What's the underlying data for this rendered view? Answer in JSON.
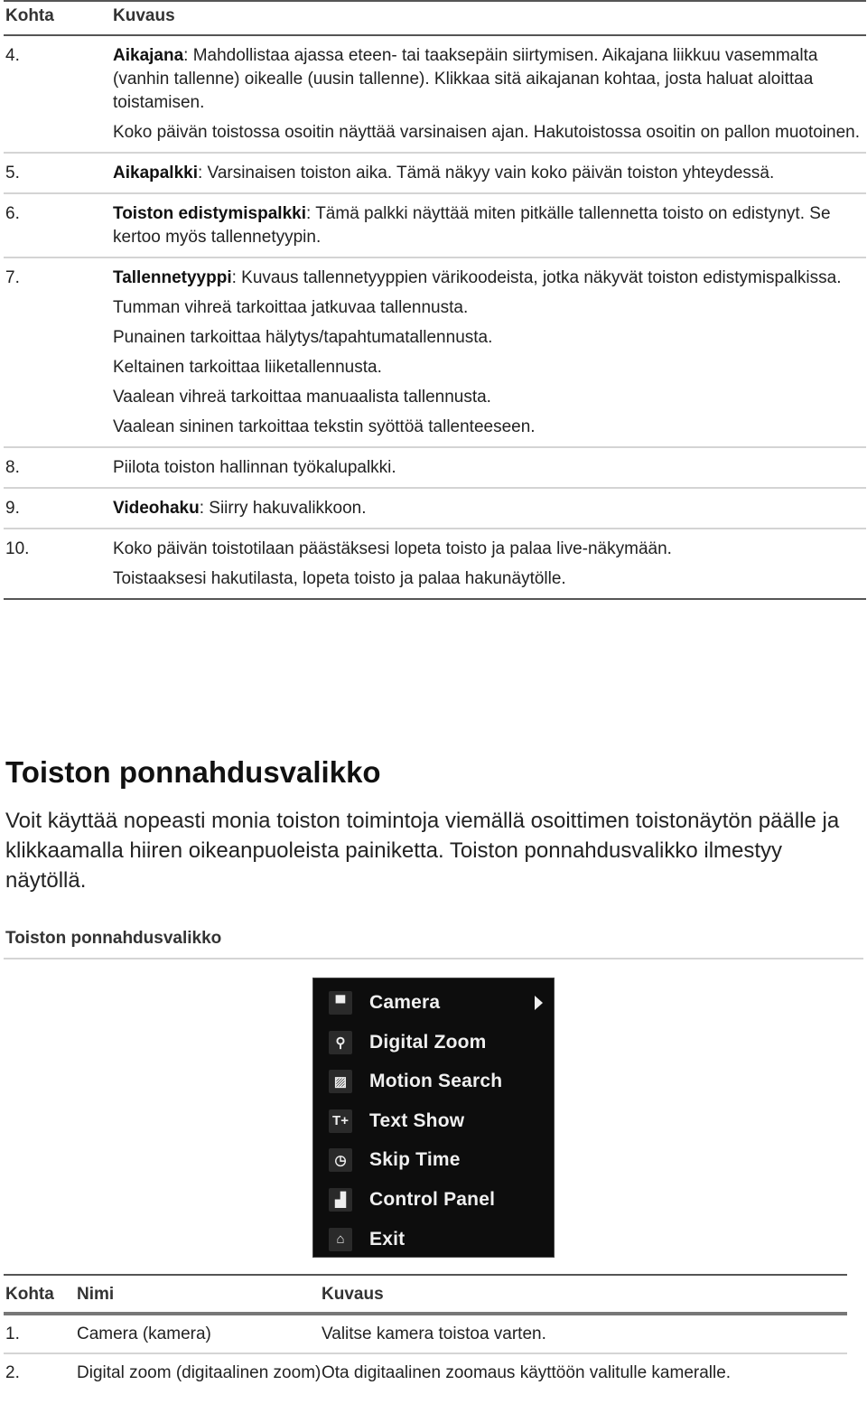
{
  "table1": {
    "headers": {
      "item": "Kohta",
      "description": "Kuvaus"
    },
    "rows": [
      {
        "num": "4.",
        "term": "Aikajana",
        "text": ": Mahdollistaa ajassa eteen- tai taaksepäin siirtymisen. Aikajana liikkuu vasemmalta (vanhin tallenne) oikealle (uusin tallenne). Klikkaa sitä aikajanan kohtaa, josta haluat aloittaa toistamisen.",
        "extra": [
          "Koko päivän toistossa osoitin näyttää varsinaisen ajan. Hakutoistossa osoitin on pallon muotoinen."
        ]
      },
      {
        "num": "5.",
        "term": "Aikapalkki",
        "text": ": Varsinaisen toiston aika. Tämä näkyy vain koko päivän toiston yhteydessä.",
        "extra": []
      },
      {
        "num": "6.",
        "term": "Toiston edistymispalkki",
        "text": ": Tämä palkki näyttää miten pitkälle tallennetta toisto on edistynyt. Se kertoo myös tallennetyypin.",
        "extra": []
      },
      {
        "num": "7.",
        "term": "Tallennetyyppi",
        "text": ": Kuvaus tallennetyyppien värikoodeista, jotka näkyvät toiston edistymispalkissa.",
        "extra": [
          "Tumman vihreä tarkoittaa jatkuvaa tallennusta.",
          "Punainen tarkoittaa hälytys/tapahtumatallennusta.",
          "Keltainen tarkoittaa liiketallennusta.",
          "Vaalean vihreä tarkoittaa manuaalista tallennusta.",
          "Vaalean sininen tarkoittaa tekstin syöttöä tallenteeseen."
        ]
      },
      {
        "num": "8.",
        "term": "",
        "text": "Piilota toiston hallinnan työkalupalkki.",
        "extra": []
      },
      {
        "num": "9.",
        "term": "Videohaku",
        "text": ": Siirry hakuvalikkoon.",
        "extra": []
      },
      {
        "num": "10.",
        "term": "",
        "text": "Koko päivän toistotilaan päästäksesi lopeta toisto ja palaa live-näkymään.",
        "extra": [
          "Toistaaksesi hakutilasta, lopeta toisto ja palaa hakunäytölle."
        ]
      }
    ]
  },
  "section": {
    "title": "Toiston ponnahdusvalikko",
    "intro": "Voit käyttää nopeasti monia toiston toimintoja viemällä osoittimen toistonäytön päälle ja klikkaamalla hiiren oikeanpuoleista painiketta. Toiston ponnahdusvalikko ilmestyy näytöllä.",
    "caption": "Toiston ponnahdusvalikko"
  },
  "menu": {
    "items": [
      {
        "label": "Camera",
        "icon": "camera-icon",
        "glyph": "▀",
        "submenu": true
      },
      {
        "label": "Digital Zoom",
        "icon": "zoom-icon",
        "glyph": "⚲",
        "submenu": false
      },
      {
        "label": "Motion Search",
        "icon": "motion-search-icon",
        "glyph": "▨",
        "submenu": false
      },
      {
        "label": "Text Show",
        "icon": "text-show-icon",
        "glyph": "T+",
        "submenu": false
      },
      {
        "label": "Skip Time",
        "icon": "clock-icon",
        "glyph": "◷",
        "submenu": false
      },
      {
        "label": "Control Panel",
        "icon": "control-panel-icon",
        "glyph": "▟",
        "submenu": false
      },
      {
        "label": "Exit",
        "icon": "exit-icon",
        "glyph": "⌂",
        "submenu": false
      }
    ]
  },
  "table2": {
    "headers": {
      "item": "Kohta",
      "name": "Nimi",
      "description": "Kuvaus"
    },
    "rows": [
      {
        "num": "1.",
        "name": "Camera (kamera)",
        "desc": "Valitse kamera toistoa varten."
      },
      {
        "num": "2.",
        "name": "Digital zoom (digitaalinen zoom)",
        "desc": "Ota digitaalinen zoomaus käyttöön valitulle kameralle."
      }
    ]
  }
}
